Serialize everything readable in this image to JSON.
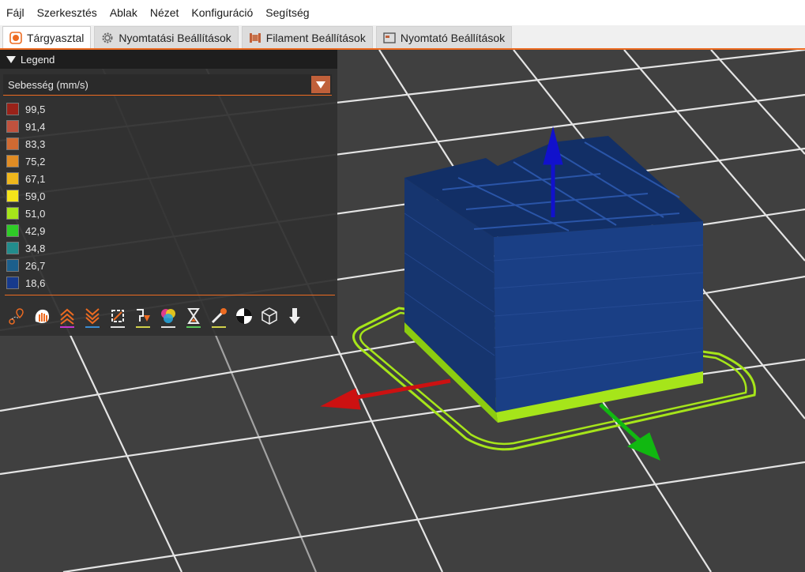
{
  "menu": [
    "Fájl",
    "Szerkesztés",
    "Ablak",
    "Nézet",
    "Konfiguráció",
    "Segítség"
  ],
  "tabs": [
    {
      "label": "Tárgyasztal",
      "icon": "plater-icon",
      "active": true
    },
    {
      "label": "Nyomtatási Beállítások",
      "icon": "gear-icon",
      "active": false
    },
    {
      "label": "Filament Beállítások",
      "icon": "filament-spool-icon",
      "active": false
    },
    {
      "label": "Nyomtató Beállítások",
      "icon": "printer-icon",
      "active": false
    }
  ],
  "legend": {
    "title": "Legend",
    "view_type": "Sebesség (mm/s)",
    "items": [
      {
        "value": "99,5",
        "color": "#9a2219"
      },
      {
        "value": "91,4",
        "color": "#c0523e"
      },
      {
        "value": "83,3",
        "color": "#d06a32"
      },
      {
        "value": "75,2",
        "color": "#e08c24"
      },
      {
        "value": "67,1",
        "color": "#efb71c"
      },
      {
        "value": "59,0",
        "color": "#f5e41a"
      },
      {
        "value": "51,0",
        "color": "#a6e51a"
      },
      {
        "value": "42,9",
        "color": "#2fcc27"
      },
      {
        "value": "34,8",
        "color": "#228c8c"
      },
      {
        "value": "26,7",
        "color": "#1c5f8c"
      },
      {
        "value": "18,6",
        "color": "#173a8c"
      }
    ],
    "toolbar": [
      {
        "name": "travel-icon",
        "underline": ""
      },
      {
        "name": "wipe-icon",
        "underline": ""
      },
      {
        "name": "retractions-icon",
        "underline": "#c437d0"
      },
      {
        "name": "deretractions-icon",
        "underline": "#3b8bd0"
      },
      {
        "name": "seams-icon",
        "underline": "#e0e0e0"
      },
      {
        "name": "tool-changes-icon",
        "underline": "#d0d04a"
      },
      {
        "name": "color-changes-icon",
        "underline": "#e0e0e0"
      },
      {
        "name": "pause-prints-icon",
        "underline": "#5ac85a"
      },
      {
        "name": "custom-gcodes-icon",
        "underline": "#d0d04a"
      },
      {
        "name": "center-of-gravity-icon",
        "underline": ""
      },
      {
        "name": "shells-icon",
        "underline": ""
      },
      {
        "name": "tool-marker-icon",
        "underline": ""
      }
    ]
  },
  "colors": {
    "accent": "#ed6b21",
    "bed_background": "#404040",
    "grid_line": "#e6e6e6",
    "model_body": "#173a8c",
    "skirt": "#a6e51a",
    "axis_x": "#cc1111",
    "axis_y": "#11b811",
    "axis_z": "#1111cc"
  }
}
